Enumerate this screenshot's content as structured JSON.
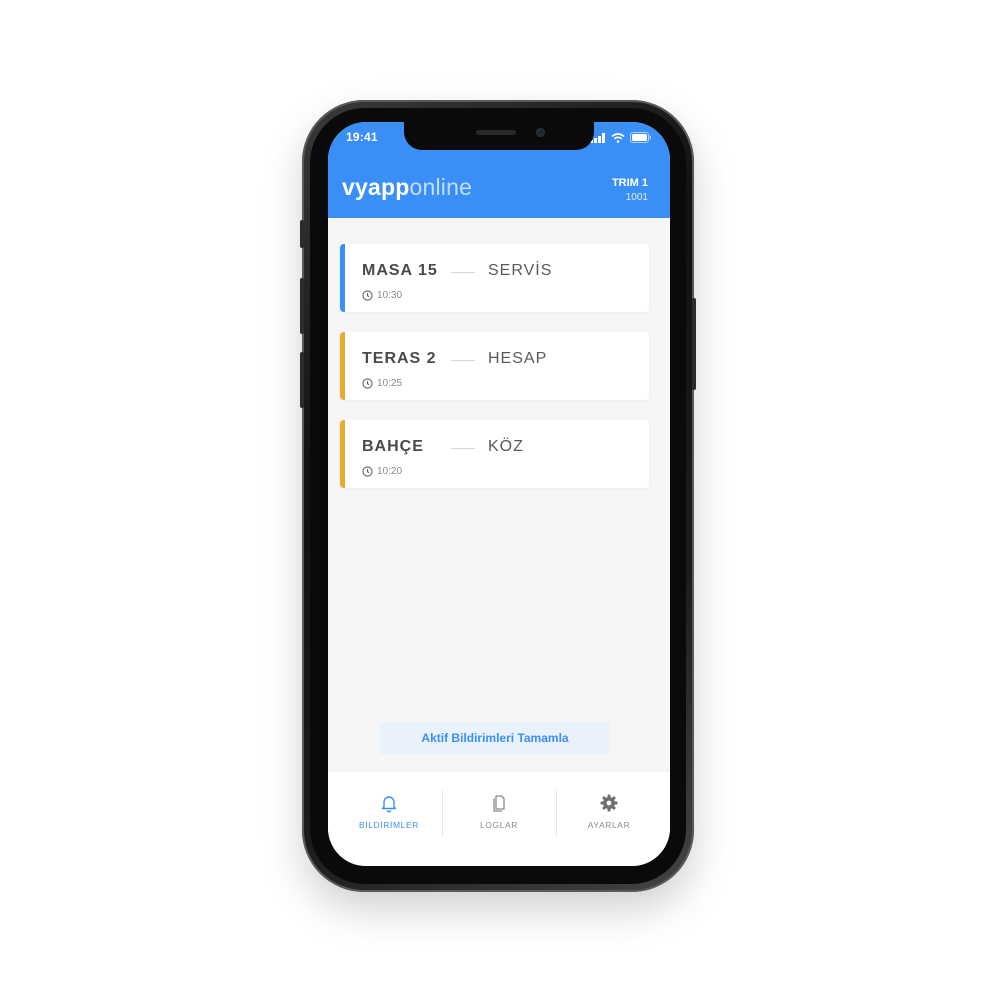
{
  "status_bar": {
    "time": "19:41"
  },
  "header": {
    "logo_bold": "vyapp",
    "logo_light": "online",
    "terminal_name": "TRIM 1",
    "terminal_id": "1001",
    "background_color": "#3a8ff7"
  },
  "notifications": [
    {
      "place": "MASA 15",
      "action": "SERVİS",
      "time": "10:30",
      "accent_color": "#3a8ff7"
    },
    {
      "place": "TERAS 2",
      "action": "HESAP",
      "time": "10:25",
      "accent_color": "#e9a92a"
    },
    {
      "place": "BAHÇE",
      "action": "KÖZ",
      "time": "10:20",
      "accent_color": "#e9a92a"
    }
  ],
  "complete_button": {
    "label": "Aktif Bildirimleri Tamamla"
  },
  "tabbar": {
    "tabs": [
      {
        "label": "BİLDİRİMLER",
        "icon": "bell-icon",
        "active": true
      },
      {
        "label": "LOGLAR",
        "icon": "document-icon",
        "active": false
      },
      {
        "label": "AYARLAR",
        "icon": "gear-icon",
        "active": false
      }
    ]
  }
}
